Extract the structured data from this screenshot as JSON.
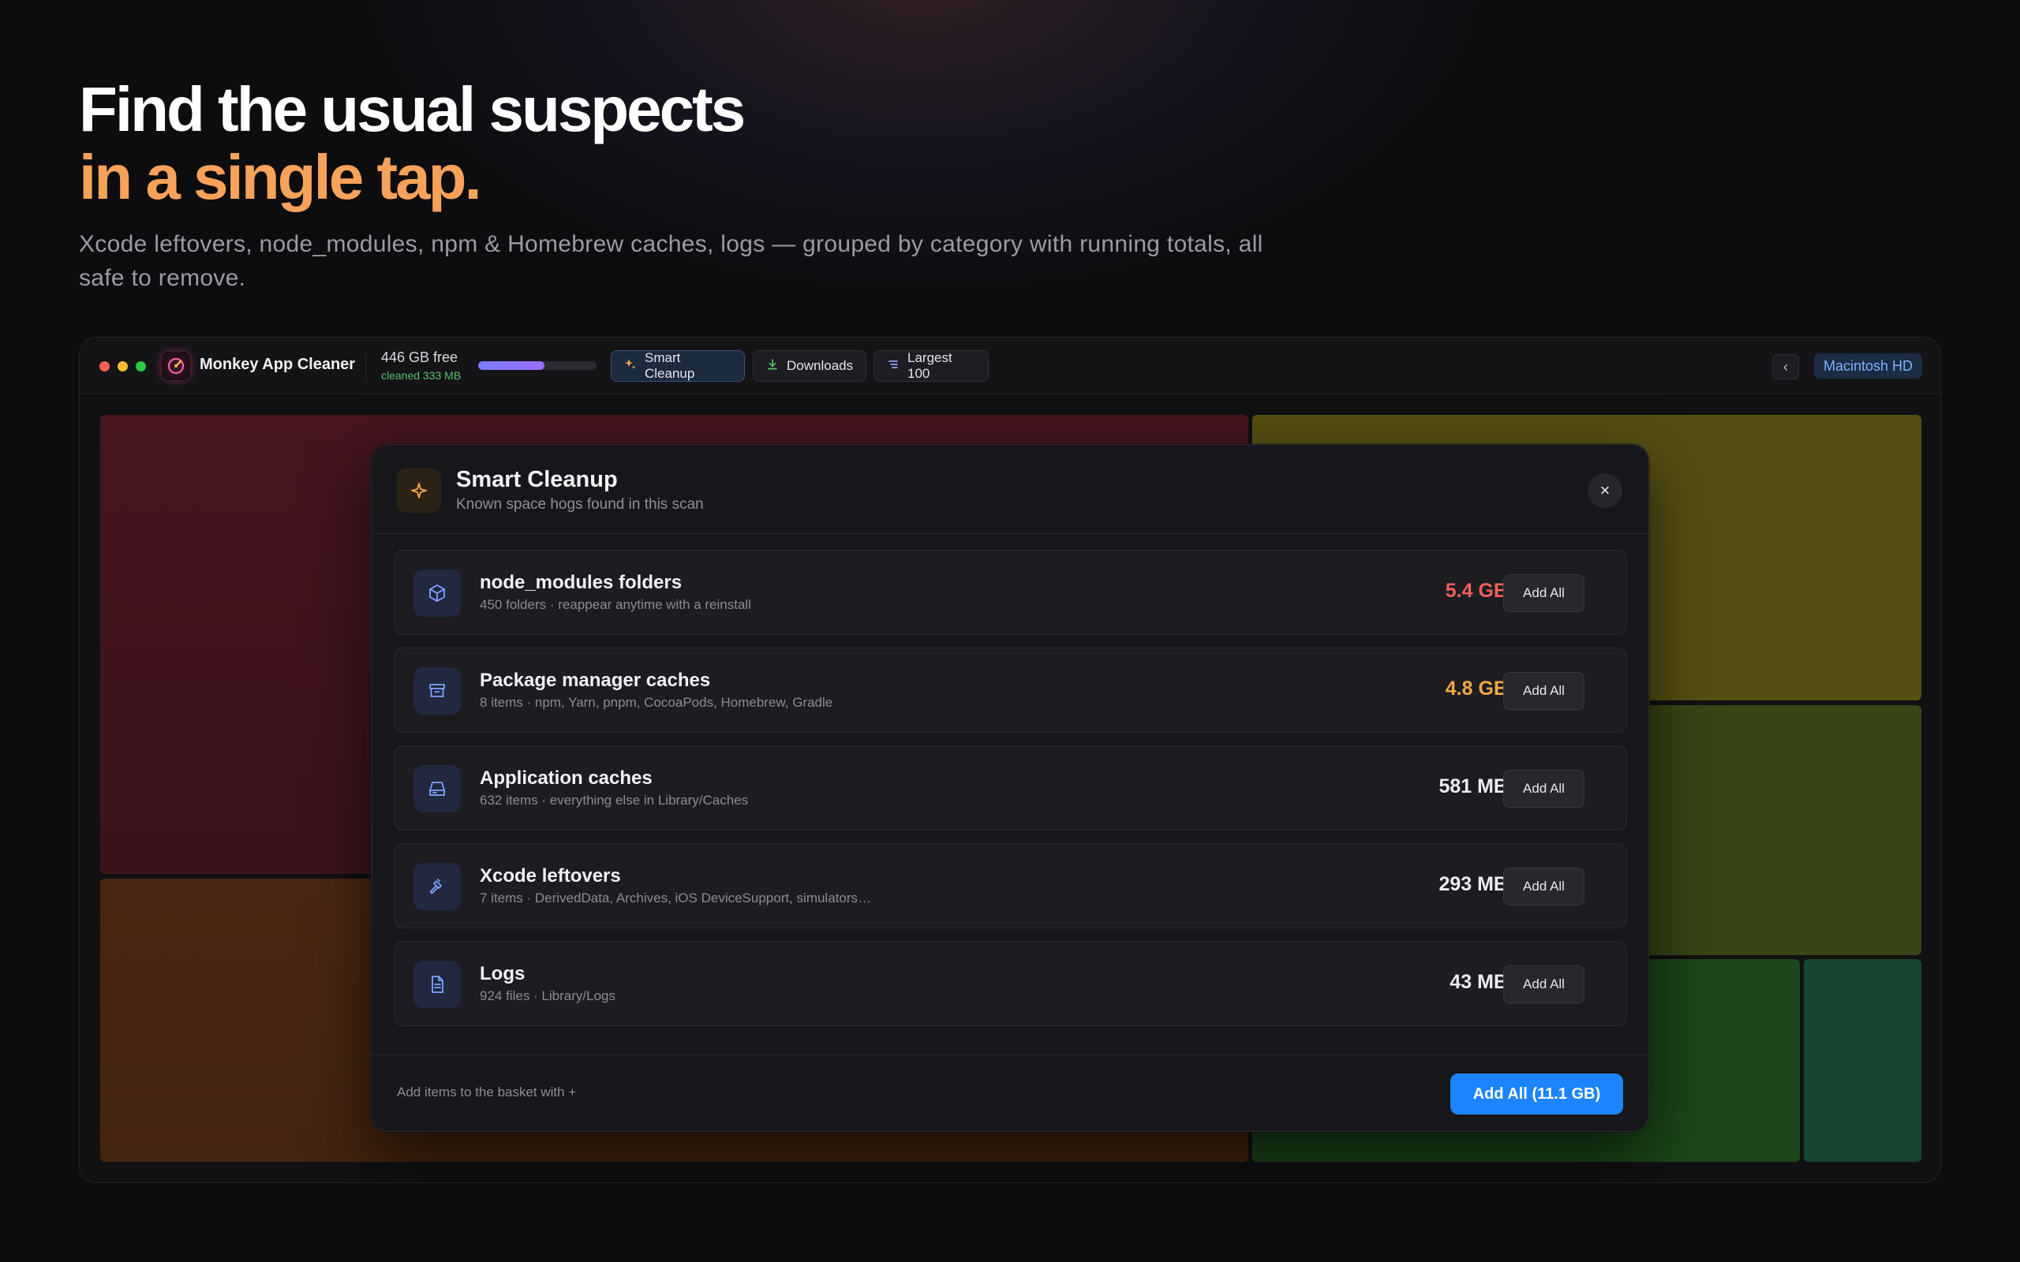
{
  "hero": {
    "title_line1": "Find the usual suspects",
    "title_line2": "in a single tap.",
    "subtitle": "Xcode leftovers, node_modules, npm & Homebrew caches, logs — grouped by category with running totals, all safe to remove."
  },
  "window": {
    "app_name": "Monkey App Cleaner",
    "disk_free": "446 GB free",
    "disk_cleaned": "cleaned 333 MB",
    "disk_used_fraction": 0.56,
    "toolbar": {
      "smart_cleanup": "Smart Cleanup",
      "downloads": "Downloads",
      "largest": "Largest 100"
    },
    "back_label": "‹",
    "disk_name": "Macintosh HD",
    "colors": {
      "accent": "#1c84ff",
      "orange": "#f7a25a",
      "red_size": "#f2605c",
      "amber_size": "#f4a742"
    }
  },
  "modal": {
    "title": "Smart Cleanup",
    "subtitle": "Known space hogs found in this scan",
    "close_label": "×",
    "rows": [
      {
        "icon": "cube-icon",
        "title": "node_modules folders",
        "desc": "450 folders · reappear anytime with a reinstall",
        "size": "5.4 GB",
        "button": "Add All"
      },
      {
        "icon": "archive-box-icon",
        "title": "Package manager caches",
        "desc": "8 items · npm, Yarn, pnpm, CocoaPods, Homebrew, Gradle",
        "size": "4.8 GB",
        "button": "Add All"
      },
      {
        "icon": "drive-icon",
        "title": "Application caches",
        "desc": "632 items · everything else in Library/Caches",
        "size": "581 MB",
        "button": "Add All"
      },
      {
        "icon": "hammer-icon",
        "title": "Xcode leftovers",
        "desc": "7 items · DerivedData, Archives, iOS DeviceSupport, simulators…",
        "size": "293 MB",
        "button": "Add All"
      },
      {
        "icon": "document-icon",
        "title": "Logs",
        "desc": "924 files · Library/Logs",
        "size": "43 MB",
        "button": "Add All"
      }
    ],
    "footer_hint": "Add items to the basket with +",
    "add_all_button": "Add All (11.1 GB)"
  }
}
